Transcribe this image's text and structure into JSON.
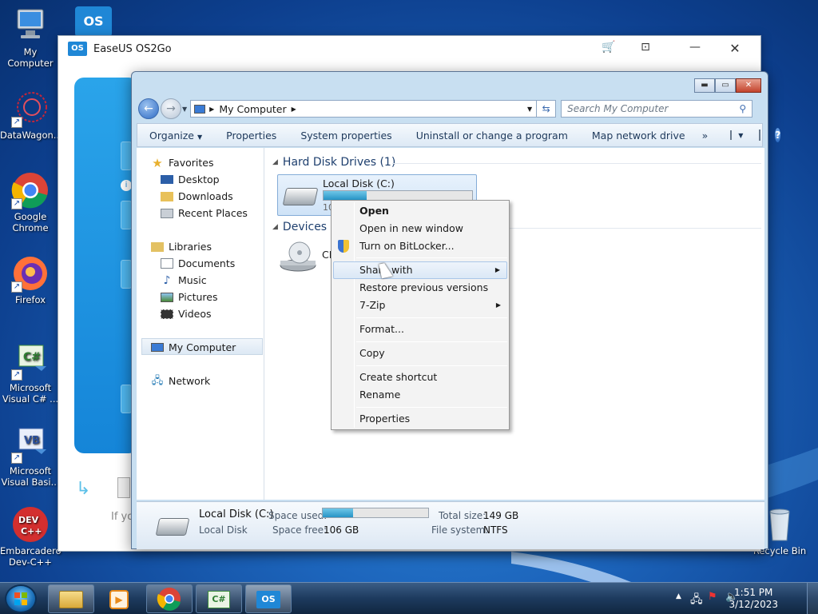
{
  "desktop": {
    "icons": [
      {
        "label": "My Computer",
        "icon": "computer-icon"
      },
      {
        "label": "DataWagon...",
        "icon": "datawagon-icon"
      },
      {
        "label": "Google Chrome",
        "icon": "chrome-icon"
      },
      {
        "label": "Firefox",
        "icon": "firefox-icon"
      },
      {
        "label": "Microsoft Visual C# ...",
        "icon": "visual-csharp-icon"
      },
      {
        "label": "Microsoft Visual Basi...",
        "icon": "visual-basic-icon"
      },
      {
        "label": "Embarcadero Dev-C++",
        "icon": "devcpp-icon"
      },
      {
        "label": "Recycle Bin",
        "icon": "recycle-bin-icon"
      }
    ]
  },
  "easeus": {
    "title": "EaseUS OS2Go",
    "logo_text": "OS",
    "partial_text": "If yo"
  },
  "explorer": {
    "address": {
      "root": "My Computer"
    },
    "search_placeholder": "Search My Computer",
    "toolbar": {
      "organize": "Organize",
      "properties": "Properties",
      "system_properties": "System properties",
      "uninstall": "Uninstall or change a program",
      "map_drive": "Map network drive",
      "more": "»"
    },
    "nav": {
      "favorites": "Favorites",
      "desktop": "Desktop",
      "downloads": "Downloads",
      "recent_places": "Recent Places",
      "libraries": "Libraries",
      "documents": "Documents",
      "music": "Music",
      "pictures": "Pictures",
      "videos": "Videos",
      "my_computer": "My Computer",
      "network": "Network"
    },
    "groups": {
      "hdd_header": "Hard Disk Drives (1)",
      "devices_header": "Devices w",
      "drive_label": "Local Disk (C:)",
      "drive_partial_free": "10",
      "cd_partial": "CD",
      "drive_used_fraction": 0.29
    },
    "details": {
      "name": "Local Disk (C:)",
      "type": "Local Disk",
      "space_used_label": "Space used:",
      "space_free_label": "Space free:",
      "space_free": "106 GB",
      "total_size_label": "Total size:",
      "total_size": "149 GB",
      "file_system_label": "File system:",
      "file_system": "NTFS",
      "used_fraction": 0.29
    }
  },
  "context_menu": {
    "open": "Open",
    "open_new_window": "Open in new window",
    "bitlocker": "Turn on BitLocker...",
    "share_with": "Share with",
    "restore": "Restore previous versions",
    "zip": "7-Zip",
    "format": "Format...",
    "copy": "Copy",
    "create_shortcut": "Create shortcut",
    "rename": "Rename",
    "properties": "Properties"
  },
  "taskbar": {
    "time": "1:51 PM",
    "date": "3/12/2023"
  },
  "colors": {
    "desktop_blue": "#1d66bd",
    "easeus_blue": "#1f87d6",
    "explorer_frame": "#c8dff1",
    "capacity_fill": "#2693c5"
  }
}
